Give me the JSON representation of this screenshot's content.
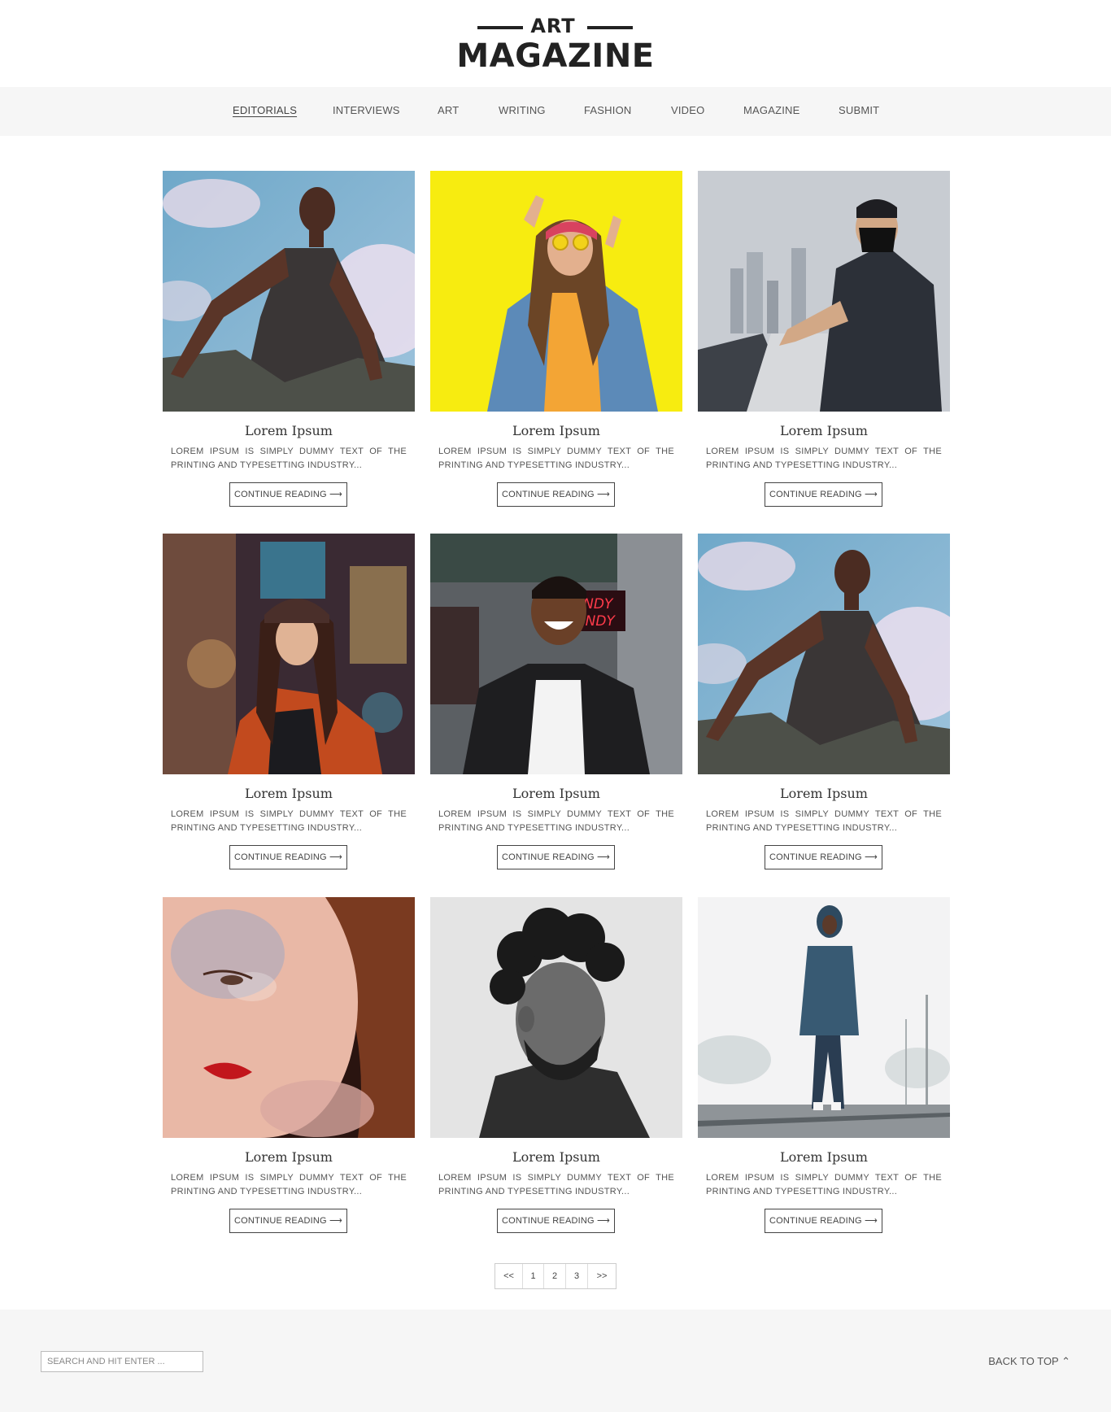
{
  "logo": {
    "top": "ART",
    "main": "MAGAZINE"
  },
  "nav": {
    "items": [
      {
        "label": "EDITORIALS",
        "active": true
      },
      {
        "label": "INTERVIEWS"
      },
      {
        "label": "ART"
      },
      {
        "label": "WRITING"
      },
      {
        "label": "FASHION"
      },
      {
        "label": "VIDEO"
      },
      {
        "label": "MAGAZINE"
      },
      {
        "label": "SUBMIT"
      }
    ]
  },
  "posts": [
    {
      "title": "Lorem Ipsum",
      "excerpt": "LOREM IPSUM IS SIMPLY DUMMY TEXT OF THE PRINTING AND TYPESETTING INDUSTRY...",
      "button": "CONTINUE READING ⟶",
      "image": "woman-sitting-sky-photo"
    },
    {
      "title": "Lorem Ipsum",
      "excerpt": "LOREM IPSUM IS SIMPLY DUMMY TEXT OF THE PRINTING AND TYPESETTING INDUSTRY...",
      "button": "CONTINUE READING ⟶",
      "image": "woman-denim-yellow-photo"
    },
    {
      "title": "Lorem Ipsum",
      "excerpt": "LOREM IPSUM IS SIMPLY DUMMY TEXT OF THE PRINTING AND TYPESETTING INDUSTRY...",
      "button": "CONTINUE READING ⟶",
      "image": "masked-man-city-photo"
    },
    {
      "title": "Lorem Ipsum",
      "excerpt": "LOREM IPSUM IS SIMPLY DUMMY TEXT OF THE PRINTING AND TYPESETTING INDUSTRY...",
      "button": "CONTINUE READING ⟶",
      "image": "woman-neon-street-photo"
    },
    {
      "title": "Lorem Ipsum",
      "excerpt": "LOREM IPSUM IS SIMPLY DUMMY TEXT OF THE PRINTING AND TYPESETTING INDUSTRY...",
      "button": "CONTINUE READING ⟶",
      "image": "smiling-man-neon-sign-photo"
    },
    {
      "title": "Lorem Ipsum",
      "excerpt": "LOREM IPSUM IS SIMPLY DUMMY TEXT OF THE PRINTING AND TYPESETTING INDUSTRY...",
      "button": "CONTINUE READING ⟶",
      "image": "woman-sitting-sky-photo"
    },
    {
      "title": "Lorem Ipsum",
      "excerpt": "LOREM IPSUM IS SIMPLY DUMMY TEXT OF THE PRINTING AND TYPESETTING INDUSTRY...",
      "button": "CONTINUE READING ⟶",
      "image": "glitter-face-portrait-photo"
    },
    {
      "title": "Lorem Ipsum",
      "excerpt": "LOREM IPSUM IS SIMPLY DUMMY TEXT OF THE PRINTING AND TYPESETTING INDUSTRY...",
      "button": "CONTINUE READING ⟶",
      "image": "bw-curly-hair-man-photo"
    },
    {
      "title": "Lorem Ipsum",
      "excerpt": "LOREM IPSUM IS SIMPLY DUMMY TEXT OF THE PRINTING AND TYPESETTING INDUSTRY...",
      "button": "CONTINUE READING ⟶",
      "image": "man-walking-rail-photo"
    }
  ],
  "pagination": {
    "prev": "<<",
    "pages": [
      "1",
      "2",
      "3"
    ],
    "next": ">>"
  },
  "footer": {
    "search_placeholder": "SEARCH AND HIT ENTER ...",
    "back_to_top": "BACK TO TOP ⌃"
  },
  "colors": {
    "nav_bg": "#f6f6f6",
    "footer_bg": "#f6f6f6",
    "text": "#333333",
    "yellow": "#f7ec10"
  }
}
